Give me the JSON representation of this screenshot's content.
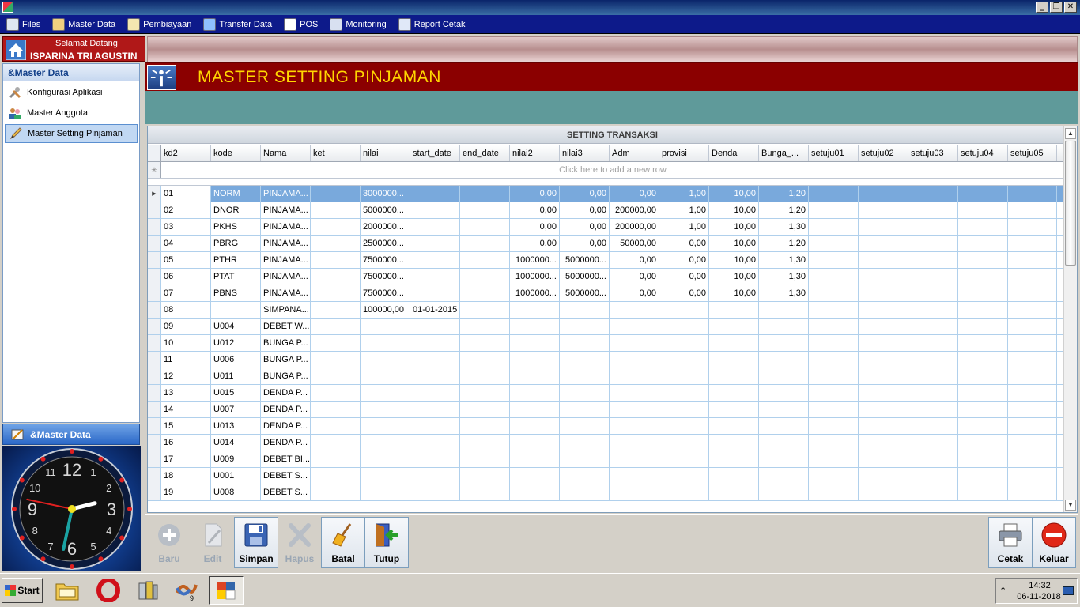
{
  "menu": {
    "items": [
      {
        "label": "Files",
        "icon": "files-icon",
        "color": "#dfe6f2"
      },
      {
        "label": "Master Data",
        "icon": "master-data-icon",
        "color": "#f0d080"
      },
      {
        "label": "Pembiayaan",
        "icon": "pembiayaan-icon",
        "color": "#f3e7b0"
      },
      {
        "label": "Transfer Data",
        "icon": "transfer-data-icon",
        "color": "#8fc0ff"
      },
      {
        "label": "POS",
        "icon": "pos-icon",
        "color": "#ffffff"
      },
      {
        "label": "Monitoring",
        "icon": "monitoring-icon",
        "color": "#d8e0f0"
      },
      {
        "label": "Report Cetak",
        "icon": "report-cetak-icon",
        "color": "#e0e8f8"
      }
    ]
  },
  "welcome": {
    "line1": "Selamat Datang",
    "line2": "ISPARINA TRI AGUSTIN"
  },
  "sidebar": {
    "header": "&Master Data",
    "items": [
      {
        "label": "Konfigurasi Aplikasi",
        "icon": "tools-icon",
        "active": false
      },
      {
        "label": "Master Anggota",
        "icon": "users-icon",
        "active": false
      },
      {
        "label": "Master Setting Pinjaman",
        "icon": "pencil-icon",
        "active": true
      }
    ],
    "footer": "&Master Data"
  },
  "clock": {
    "hour": 2,
    "minute": 32,
    "second": 47
  },
  "banner": {
    "title": "MASTER SETTING PINJAMAN"
  },
  "grid": {
    "caption": "SETTING TRANSAKSI",
    "new_row_text": "Click here to add a new row",
    "columns": [
      "kd2",
      "kode",
      "Nama",
      "ket",
      "nilai",
      "start_date",
      "end_date",
      "nilai2",
      "nilai3",
      "Adm",
      "provisi",
      "Denda",
      "Bunga_...",
      "setuju01",
      "setuju02",
      "setuju03",
      "setuju04",
      "setuju05"
    ],
    "rows": [
      [
        "01",
        "NORM",
        "PINJAMA...",
        "",
        "3000000...",
        "",
        "",
        "0,00",
        "0,00",
        "0,00",
        "1,00",
        "10,00",
        "1,20",
        "",
        "",
        "",
        "",
        ""
      ],
      [
        "02",
        "DNOR",
        "PINJAMA...",
        "",
        "5000000...",
        "",
        "",
        "0,00",
        "0,00",
        "200000,00",
        "1,00",
        "10,00",
        "1,20",
        "",
        "",
        "",
        "",
        ""
      ],
      [
        "03",
        "PKHS",
        "PINJAMA...",
        "",
        "2000000...",
        "",
        "",
        "0,00",
        "0,00",
        "200000,00",
        "1,00",
        "10,00",
        "1,30",
        "",
        "",
        "",
        "",
        ""
      ],
      [
        "04",
        "PBRG",
        "PINJAMA...",
        "",
        "2500000...",
        "",
        "",
        "0,00",
        "0,00",
        "50000,00",
        "0,00",
        "10,00",
        "1,20",
        "",
        "",
        "",
        "",
        ""
      ],
      [
        "05",
        "PTHR",
        "PINJAMA...",
        "",
        "7500000...",
        "",
        "",
        "1000000...",
        "5000000...",
        "0,00",
        "0,00",
        "10,00",
        "1,30",
        "",
        "",
        "",
        "",
        ""
      ],
      [
        "06",
        "PTAT",
        "PINJAMA...",
        "",
        "7500000...",
        "",
        "",
        "1000000...",
        "5000000...",
        "0,00",
        "0,00",
        "10,00",
        "1,30",
        "",
        "",
        "",
        "",
        ""
      ],
      [
        "07",
        "PBNS",
        "PINJAMA...",
        "",
        "7500000...",
        "",
        "",
        "1000000...",
        "5000000...",
        "0,00",
        "0,00",
        "10,00",
        "1,30",
        "",
        "",
        "",
        "",
        ""
      ],
      [
        "08",
        "",
        "SIMPANA...",
        "",
        "100000,00",
        "01-01-2015",
        "",
        "",
        "",
        "",
        "",
        "",
        "",
        "",
        "",
        "",
        "",
        ""
      ],
      [
        "09",
        "U004",
        "DEBET W...",
        "",
        "",
        "",
        "",
        "",
        "",
        "",
        "",
        "",
        "",
        "",
        "",
        "",
        "",
        ""
      ],
      [
        "10",
        "U012",
        "BUNGA P...",
        "",
        "",
        "",
        "",
        "",
        "",
        "",
        "",
        "",
        "",
        "",
        "",
        "",
        "",
        ""
      ],
      [
        "11",
        "U006",
        "BUNGA P...",
        "",
        "",
        "",
        "",
        "",
        "",
        "",
        "",
        "",
        "",
        "",
        "",
        "",
        "",
        ""
      ],
      [
        "12",
        "U011",
        "BUNGA P...",
        "",
        "",
        "",
        "",
        "",
        "",
        "",
        "",
        "",
        "",
        "",
        "",
        "",
        "",
        ""
      ],
      [
        "13",
        "U015",
        "DENDA P...",
        "",
        "",
        "",
        "",
        "",
        "",
        "",
        "",
        "",
        "",
        "",
        "",
        "",
        "",
        ""
      ],
      [
        "14",
        "U007",
        "DENDA P...",
        "",
        "",
        "",
        "",
        "",
        "",
        "",
        "",
        "",
        "",
        "",
        "",
        "",
        "",
        ""
      ],
      [
        "15",
        "U013",
        "DENDA P...",
        "",
        "",
        "",
        "",
        "",
        "",
        "",
        "",
        "",
        "",
        "",
        "",
        "",
        "",
        ""
      ],
      [
        "16",
        "U014",
        "DENDA P...",
        "",
        "",
        "",
        "",
        "",
        "",
        "",
        "",
        "",
        "",
        "",
        "",
        "",
        "",
        ""
      ],
      [
        "17",
        "U009",
        "DEBET BI...",
        "",
        "",
        "",
        "",
        "",
        "",
        "",
        "",
        "",
        "",
        "",
        "",
        "",
        "",
        ""
      ],
      [
        "18",
        "U001",
        "DEBET S...",
        "",
        "",
        "",
        "",
        "",
        "",
        "",
        "",
        "",
        "",
        "",
        "",
        "",
        "",
        ""
      ],
      [
        "19",
        "U008",
        "DEBET S...",
        "",
        "",
        "",
        "",
        "",
        "",
        "",
        "",
        "",
        "",
        "",
        "",
        "",
        "",
        ""
      ]
    ],
    "selected_row": 0
  },
  "toolbar": {
    "buttons": [
      {
        "label": "Baru",
        "icon": "plus-icon",
        "enabled": false
      },
      {
        "label": "Edit",
        "icon": "edit-icon",
        "enabled": false
      },
      {
        "label": "Simpan",
        "icon": "save-icon",
        "enabled": true
      },
      {
        "label": "Hapus",
        "icon": "delete-icon",
        "enabled": false
      },
      {
        "label": "Batal",
        "icon": "broom-icon",
        "enabled": true
      },
      {
        "label": "Tutup",
        "icon": "exit-door-icon",
        "enabled": true
      }
    ],
    "right_buttons": [
      {
        "label": "Cetak",
        "icon": "printer-icon",
        "enabled": true
      },
      {
        "label": "Keluar",
        "icon": "stop-icon",
        "enabled": true
      }
    ]
  },
  "taskbar": {
    "start_label": "Start",
    "time": "14:32",
    "date": "06-11-2018"
  },
  "colors": {
    "accent": "#8b0000",
    "banner_text": "#ffd700",
    "selection": "#79a9dc",
    "menu_bg": "#0d1a8a"
  }
}
